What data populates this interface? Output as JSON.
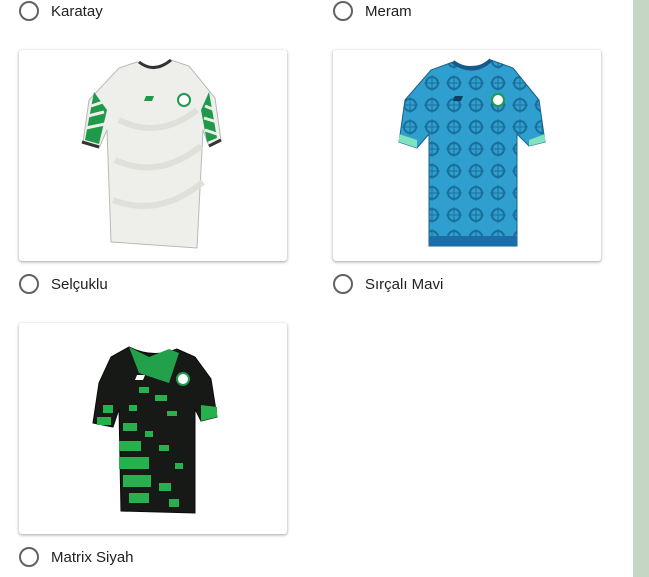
{
  "options": [
    {
      "label": "Karatay",
      "selected": false
    },
    {
      "label": "Meram",
      "selected": false
    },
    {
      "label": "Selçuklu",
      "selected": false,
      "image": "white-green-jersey"
    },
    {
      "label": "Sırçalı Mavi",
      "selected": false,
      "image": "blue-pattern-jersey"
    },
    {
      "label": "Matrix Siyah",
      "selected": false,
      "image": "black-green-matrix-jersey"
    }
  ],
  "colors": {
    "sidebar": "#c5d6c5",
    "radio_border": "#5f6368",
    "text": "#202124"
  }
}
